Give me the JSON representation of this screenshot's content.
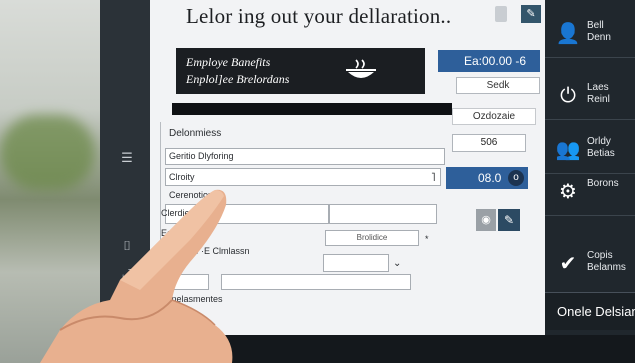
{
  "header": {
    "title": "Lelor ing out your dellaration..",
    "top_button_icon": "pencil-icon"
  },
  "banner": {
    "line1": "Employe Banefits",
    "line2": "Enplol]ee Brelordans",
    "logo_icon": "bowl-icon"
  },
  "date_field": {
    "value": "Ea:00.00 -6",
    "icon": "chevron-left-icon"
  },
  "small_field": {
    "value": "Sedk"
  },
  "right_note": {
    "value": "Ozdozaie"
  },
  "form": {
    "section_label": "Delonmiess",
    "row1_label": "Geritio Dlyforing",
    "row2_label": "Clroity",
    "row3_label": "Cerenotion",
    "row4_label": "Clerdiew",
    "row5_label": "Eo",
    "row5_sub": "7me ·E Clmlassn",
    "row5_button": "Brolidice",
    "bottom_label": "Conelasmentes"
  },
  "values": {
    "v506": "506",
    "v080": "08.0"
  },
  "sidebar": {
    "items": [
      {
        "label": "Bell\nDenn",
        "icon": "person-bag-icon"
      },
      {
        "label": "Laes\nReinl",
        "icon": "power-icon"
      },
      {
        "label": "Orldy\nBetias",
        "icon": "user-group-icon"
      },
      {
        "label": "Borons",
        "icon": "gear-icon"
      },
      {
        "label": "Copis\nBelanms",
        "icon": "checkmark-icon"
      }
    ],
    "bottom_label": "Onele Delsian"
  },
  "colors": {
    "accent_blue": "#2e5f9a",
    "sidebar_bg": "#20272d",
    "banner_bg": "#1b1e22"
  }
}
